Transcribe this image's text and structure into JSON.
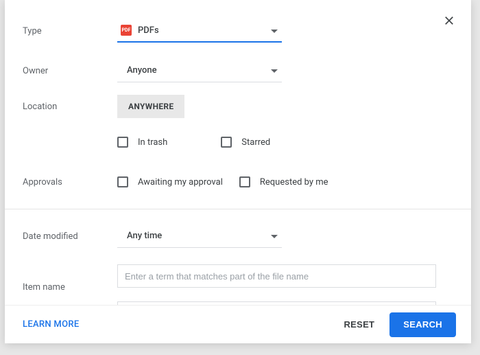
{
  "labels": {
    "type": "Type",
    "owner": "Owner",
    "location": "Location",
    "approvals": "Approvals",
    "date_modified": "Date modified",
    "item_name": "Item name"
  },
  "type": {
    "value": "PDFs",
    "icon_label": "PDF"
  },
  "owner": {
    "value": "Anyone"
  },
  "location": {
    "chip": "ANYWHERE"
  },
  "location_checks": {
    "in_trash": "In trash",
    "starred": "Starred"
  },
  "approvals_checks": {
    "awaiting": "Awaiting my approval",
    "requested": "Requested by me"
  },
  "date_modified": {
    "value": "Any time"
  },
  "item_name": {
    "value": "",
    "placeholder": "Enter a term that matches part of the file name"
  },
  "footer": {
    "learn_more": "LEARN MORE",
    "reset": "RESET",
    "search": "SEARCH"
  }
}
